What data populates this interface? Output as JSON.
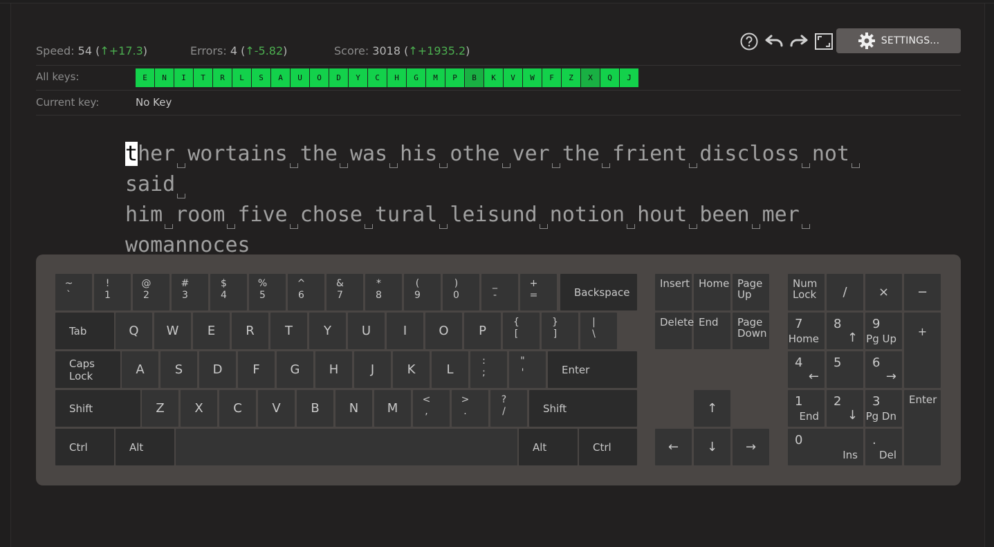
{
  "toolbar": {
    "settings_label": "SETTINGS...",
    "icons": [
      "help-icon",
      "undo-icon",
      "redo-icon",
      "fullscreen-icon",
      "gear-icon"
    ]
  },
  "stats": {
    "speed_label": "Speed:",
    "speed_value": "54",
    "speed_delta": "+17.3",
    "errors_label": "Errors:",
    "errors_value": "4",
    "errors_delta": "-5.82",
    "score_label": "Score:",
    "score_value": "3018",
    "score_delta": "+1935.2",
    "open_paren": "(",
    "close_paren": ")",
    "arrow": "↑",
    "delta_color": "#4caf50"
  },
  "all_keys": {
    "label": "All keys:",
    "keys": [
      "E",
      "N",
      "I",
      "T",
      "R",
      "L",
      "S",
      "A",
      "U",
      "O",
      "D",
      "Y",
      "C",
      "H",
      "G",
      "M",
      "P",
      "B",
      "K",
      "V",
      "W",
      "F",
      "Z",
      "X",
      "Q",
      "J"
    ],
    "chip_color": "#13d14b"
  },
  "current_key": {
    "label": "Current key:",
    "value": "No Key"
  },
  "lesson": {
    "cursor_char": "t",
    "lines": [
      [
        "her",
        "wortains",
        "the",
        "was",
        "his",
        "othe",
        "ver",
        "the",
        "frient",
        "discloss",
        "not",
        "said"
      ],
      [
        "him",
        "room",
        "five",
        "chose",
        "tural",
        "leisund",
        "notion",
        "hout",
        "been",
        "mer"
      ],
      [
        "womannoces"
      ]
    ]
  },
  "keyboard": {
    "row1": [
      [
        "~",
        "`"
      ],
      [
        "!",
        "1"
      ],
      [
        "@",
        "2"
      ],
      [
        "#",
        "3"
      ],
      [
        "$",
        "4"
      ],
      [
        "%",
        "5"
      ],
      [
        "^",
        "6"
      ],
      [
        "&",
        "7"
      ],
      [
        "*",
        "8"
      ],
      [
        "(",
        "9"
      ],
      [
        ")",
        "0"
      ],
      [
        "_",
        "-"
      ],
      [
        "+",
        "="
      ]
    ],
    "backspace": "Backspace",
    "tab": "Tab",
    "row2": [
      "Q",
      "W",
      "E",
      "R",
      "T",
      "Y",
      "U",
      "I",
      "O",
      "P"
    ],
    "row2_sym": [
      [
        "{",
        "["
      ],
      [
        "}",
        "]"
      ],
      [
        "|",
        "\\"
      ]
    ],
    "caps": "Caps Lock",
    "row3": [
      "A",
      "S",
      "D",
      "F",
      "G",
      "H",
      "J",
      "K",
      "L"
    ],
    "row3_sym": [
      [
        ":",
        ";"
      ],
      [
        "\"",
        "'"
      ]
    ],
    "enter": "Enter",
    "shift": "Shift",
    "row4": [
      "Z",
      "X",
      "C",
      "V",
      "B",
      "N",
      "M"
    ],
    "row4_sym": [
      [
        "<",
        ","
      ],
      [
        ">",
        "."
      ],
      [
        "?",
        "/"
      ]
    ],
    "ctrl": "Ctrl",
    "alt": "Alt",
    "nav": {
      "insert": "Insert",
      "home": "Home",
      "page_up": [
        "Page",
        "Up"
      ],
      "delete": "Delete",
      "end": "End",
      "page_down": [
        "Page",
        "Down"
      ],
      "up": "↑",
      "left": "←",
      "down": "↓",
      "right": "→"
    },
    "numpad": {
      "numlock": [
        "Num",
        "Lock"
      ],
      "divide": "/",
      "multiply": "×",
      "minus": "−",
      "plus": "+",
      "enter": "Enter",
      "n7": [
        "7",
        "Home"
      ],
      "n8": [
        "8",
        "↑"
      ],
      "n9": [
        "9",
        "Pg Up"
      ],
      "n4": [
        "4",
        "←"
      ],
      "n5": [
        "5",
        ""
      ],
      "n6": [
        "6",
        "→"
      ],
      "n1": [
        "1",
        "End"
      ],
      "n2": [
        "2",
        "↓"
      ],
      "n3": [
        "3",
        "Pg Dn"
      ],
      "n0": [
        "0",
        "Ins"
      ],
      "ndot": [
        ".",
        "Del"
      ]
    }
  }
}
